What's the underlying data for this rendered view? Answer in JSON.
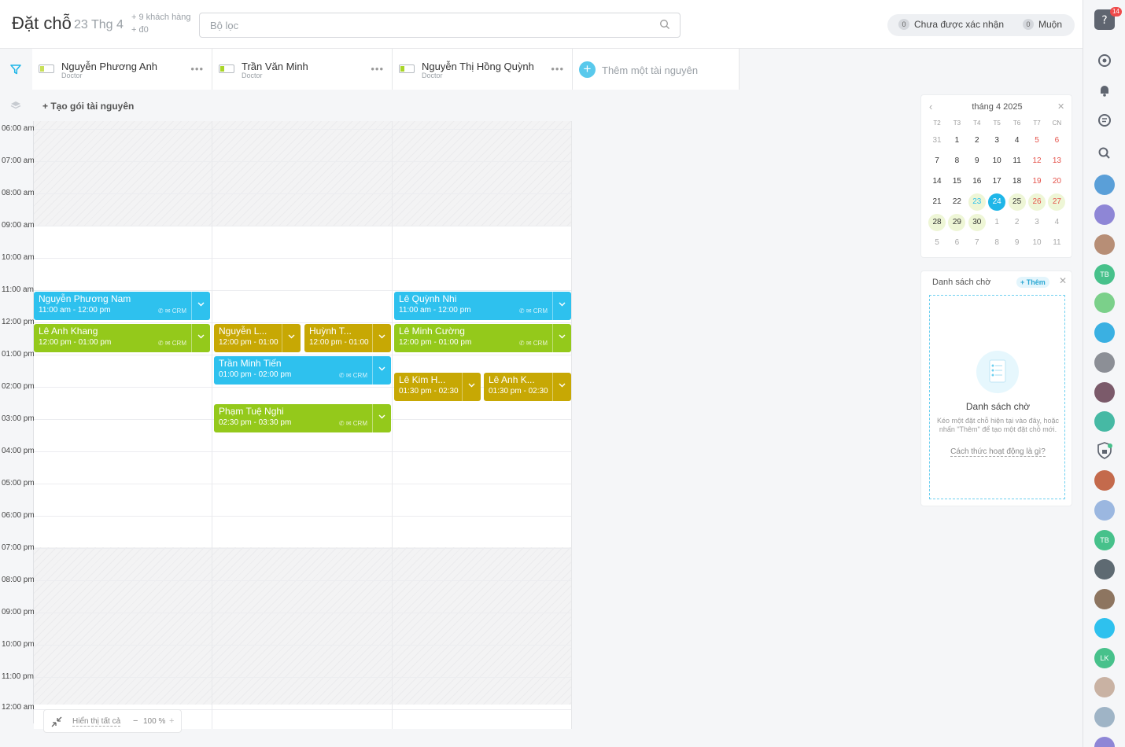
{
  "header": {
    "title": "Đặt chỗ",
    "date": "23 Thg 4",
    "extra_line1": "+ 9 khách hàng",
    "extra_line2": "+ đ0",
    "search_placeholder": "Bộ lọc",
    "unconfirmed_count": "0",
    "unconfirmed_label": "Chưa được xác nhận",
    "late_count": "0",
    "late_label": "Muộn"
  },
  "resources": [
    {
      "name": "Nguyễn Phương Anh",
      "role": "Doctor"
    },
    {
      "name": "Trần Văn Minh",
      "role": "Doctor"
    },
    {
      "name": "Nguyễn Thị Hồng Quỳnh",
      "role": "Doctor"
    }
  ],
  "add_resource": "Thêm một tài nguyên",
  "create_package": "+ Tạo gói tài nguyên",
  "time_labels": [
    "06:00 am",
    "07:00 am",
    "08:00 am",
    "09:00 am",
    "10:00 am",
    "11:00 am",
    "12:00 pm",
    "01:00 pm",
    "02:00 pm",
    "03:00 pm",
    "04:00 pm",
    "05:00 pm",
    "06:00 pm",
    "07:00 pm",
    "08:00 pm",
    "09:00 pm",
    "10:00 pm",
    "11:00 pm",
    "12:00 am"
  ],
  "events": [
    {
      "name": "Nguyễn Phương Nam",
      "time": "11:00 am - 12:00 pm",
      "color": "blue"
    },
    {
      "name": "Lê Anh Khang",
      "time": "12:00 pm - 01:00 pm",
      "color": "green"
    },
    {
      "name": "Nguyễn L...",
      "time": "12:00 pm - 01:00",
      "color": "olive"
    },
    {
      "name": "Huỳnh T...",
      "time": "12:00 pm - 01:00",
      "color": "olive"
    },
    {
      "name": "Trần Minh Tiến",
      "time": "01:00 pm - 02:00 pm",
      "color": "blue"
    },
    {
      "name": "Phạm Tuệ Nghi",
      "time": "02:30 pm - 03:30 pm",
      "color": "green"
    },
    {
      "name": "Lê Quỳnh Nhi",
      "time": "11:00 am - 12:00 pm",
      "color": "blue"
    },
    {
      "name": "Lê Minh Cường",
      "time": "12:00 pm - 01:00 pm",
      "color": "green"
    },
    {
      "name": "Lê Kim H...",
      "time": "01:30 pm - 02:30",
      "color": "olive"
    },
    {
      "name": "Lê Anh K...",
      "time": "01:30 pm - 02:30",
      "color": "olive"
    }
  ],
  "event_crm": "CRM",
  "zoom": {
    "show_all": "Hiển thị tất cả",
    "value": "100 %",
    "minus": "−",
    "plus": "+"
  },
  "calendar": {
    "month": "tháng 4 2025",
    "weekdays": [
      "T2",
      "T3",
      "T4",
      "T5",
      "T6",
      "T7",
      "CN"
    ],
    "days": [
      [
        "31",
        "1",
        "2",
        "3",
        "4",
        "5",
        "6"
      ],
      [
        "7",
        "8",
        "9",
        "10",
        "11",
        "12",
        "13"
      ],
      [
        "14",
        "15",
        "16",
        "17",
        "18",
        "19",
        "20"
      ],
      [
        "21",
        "22",
        "23",
        "24",
        "25",
        "26",
        "27"
      ],
      [
        "28",
        "29",
        "30",
        "1",
        "2",
        "3",
        "4"
      ],
      [
        "5",
        "6",
        "7",
        "8",
        "9",
        "10",
        "11"
      ]
    ],
    "selected": "24",
    "today": "23"
  },
  "waitlist": {
    "title": "Danh sách chờ",
    "add": "+ Thêm",
    "empty_title": "Danh sách chờ",
    "empty_desc": "Kéo một đặt chỗ hiện tại vào đây, hoặc nhấn \"Thêm\" để tạo một đặt chỗ mới.",
    "how_link": "Cách thức hoạt động là gì?"
  },
  "sidebar": {
    "help_badge": "14",
    "avatar_initials": [
      "TB",
      "TB",
      "LK"
    ]
  },
  "colors": {
    "blue": "#2ec1ee",
    "green": "#94c91b",
    "olive": "#c7a804",
    "accent": "#1fb6e8"
  }
}
